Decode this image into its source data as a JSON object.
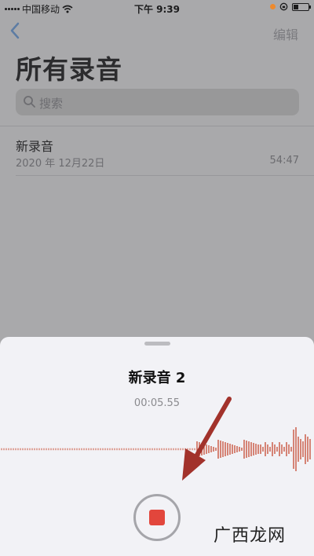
{
  "status_bar": {
    "carrier": "中国移动",
    "time": "下午 9:39"
  },
  "nav": {
    "back_icon": "chevron-left-icon",
    "edit_label": "编辑"
  },
  "page_title": "所有录音",
  "search": {
    "placeholder": "搜索"
  },
  "recordings": [
    {
      "name": "新录音",
      "date": "2020 年 12月22日",
      "duration": "54:47"
    }
  ],
  "sheet": {
    "title": "新录音 2",
    "elapsed": "00:05.55"
  },
  "colors": {
    "accent_blue": "#5d7ca3",
    "record_red": "#e2463c",
    "arrow_red": "#a2322b",
    "waveform": "#c9553f"
  },
  "watermark": "广西龙网"
}
